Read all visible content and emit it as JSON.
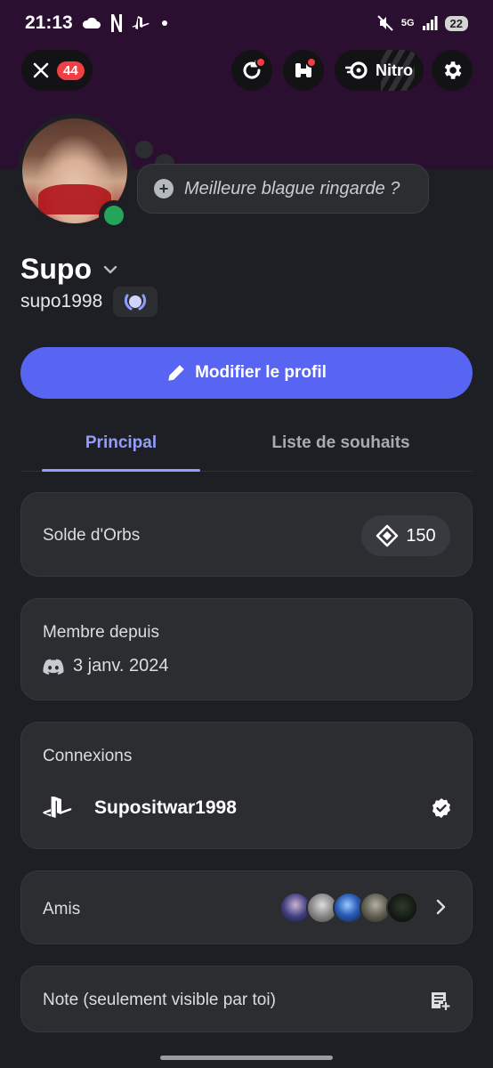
{
  "status_bar": {
    "time": "21:13",
    "battery": "22",
    "network": "5G"
  },
  "top_bar": {
    "notification_count": "44",
    "nitro_label": "Nitro"
  },
  "profile": {
    "custom_status_placeholder": "Meilleure blague ringarde ?",
    "display_name": "Supo",
    "username": "supo1998",
    "edit_button_label": "Modifier le profil"
  },
  "tabs": [
    {
      "label": "Principal",
      "active": true
    },
    {
      "label": "Liste de souhaits",
      "active": false
    }
  ],
  "orbs": {
    "title": "Solde d'Orbs",
    "balance": "150"
  },
  "member_since": {
    "title": "Membre depuis",
    "date": "3 janv. 2024"
  },
  "connections": {
    "title": "Connexions",
    "items": [
      {
        "platform": "playstation-icon",
        "name": "Supositwar1998",
        "verified": true
      }
    ]
  },
  "friends": {
    "title": "Amis"
  },
  "note": {
    "title": "Note (seulement visible par toi)"
  },
  "colors": {
    "accent": "#5865f2",
    "tab_active": "#959dfc",
    "online": "#23a55a",
    "badge": "#f23f43",
    "banner": "#2b0f30",
    "background": "#1e1f24",
    "card": "#2b2d31"
  }
}
